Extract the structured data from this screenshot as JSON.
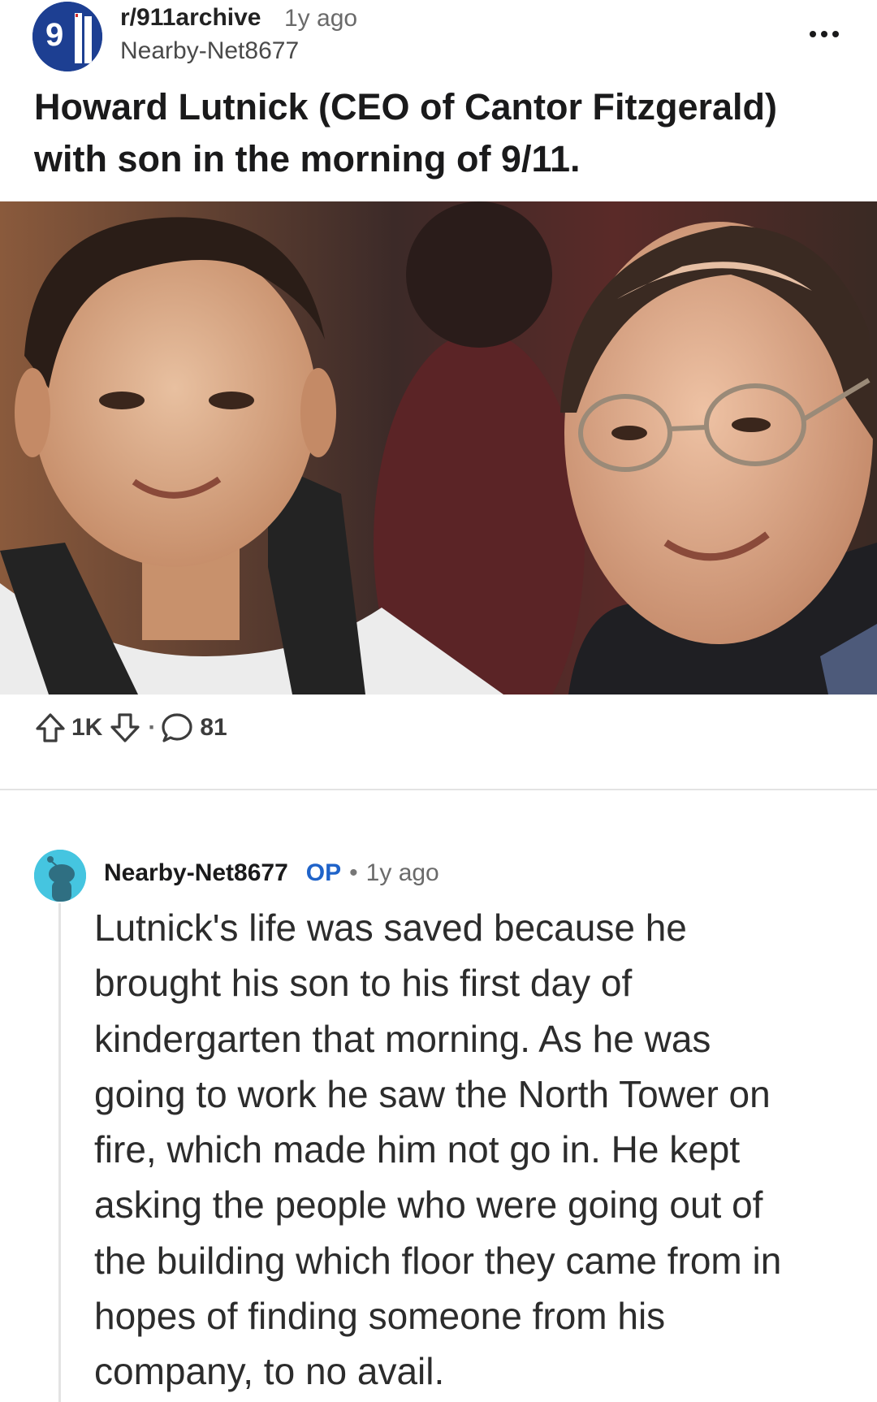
{
  "post": {
    "subreddit": "r/911archive",
    "age": "1y ago",
    "author": "Nearby-Net8677",
    "more_icon": "ellipsis-icon",
    "subreddit_icon": "subreddit-911-icon",
    "subreddit_icon_text": "9",
    "title": "Howard Lutnick (CEO of Cantor Fitzgerald) with son in the morning of 9/11.",
    "image_icon": "photo",
    "upvotes": "1K",
    "separator": "·",
    "comments": "81",
    "upvote_icon": "arrow-up-icon",
    "downvote_icon": "arrow-down-icon",
    "comment_icon": "speech-bubble-icon"
  },
  "comment": {
    "author": "Nearby-Net8677",
    "badge": "OP",
    "separator": "•",
    "age": "1y ago",
    "avatar_icon": "snoo-avatar-icon",
    "lines": [
      "Lutnick's life was saved because he",
      "brought his son to his first day of",
      "kindergarten that morning. As he was",
      "going to work he saw the North Tower on",
      "fire, which made him not go in. He kept",
      "asking the people who were going out of",
      "the building which floor they came from in",
      "hopes of finding someone from his",
      "company, to no avail."
    ]
  },
  "colors": {
    "op_blue": "#1f63c9",
    "sub_avatar_bg": "#1d3f92",
    "comment_avatar_bg": "#45c5e0",
    "divider": "#e3e3e3"
  }
}
